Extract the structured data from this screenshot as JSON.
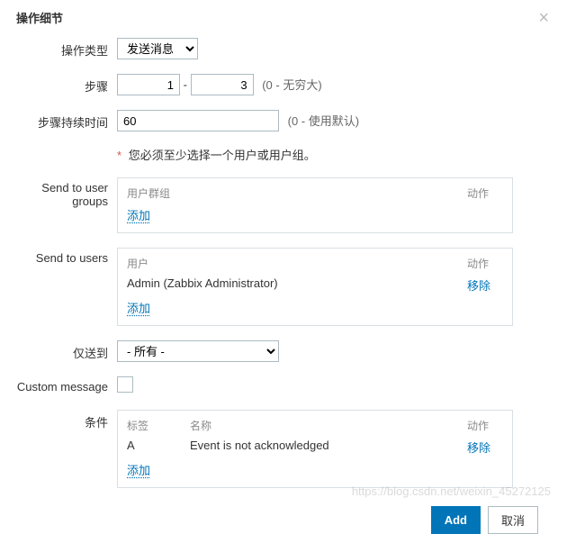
{
  "header": {
    "title": "操作细节"
  },
  "form": {
    "op_type_label": "操作类型",
    "op_type_value": "发送消息",
    "steps_label": "步骤",
    "steps_from": "1",
    "steps_to": "3",
    "steps_hint": "(0 - 无穷大)",
    "duration_label": "步骤持续时间",
    "duration_value": "60",
    "duration_hint": "(0 - 使用默认)",
    "required_note": "您必须至少选择一个用户或用户组。",
    "send_groups_label": "Send to user groups",
    "send_users_label": "Send to users",
    "send_via_label": "仅送到",
    "send_via_value": "- 所有 -",
    "custom_msg_label": "Custom message",
    "conditions_label": "条件"
  },
  "cols": {
    "group": "用户群组",
    "user": "用户",
    "action": "动作",
    "tag": "标签",
    "name": "名称"
  },
  "users": {
    "row1_name": "Admin (Zabbix Administrator)"
  },
  "conditions": {
    "row1_tag": "A",
    "row1_name": "Event is not acknowledged"
  },
  "links": {
    "add": "添加",
    "remove": "移除"
  },
  "footer": {
    "add": "Add",
    "cancel": "取消"
  },
  "watermark": "https://blog.csdn.net/weixin_45272125"
}
